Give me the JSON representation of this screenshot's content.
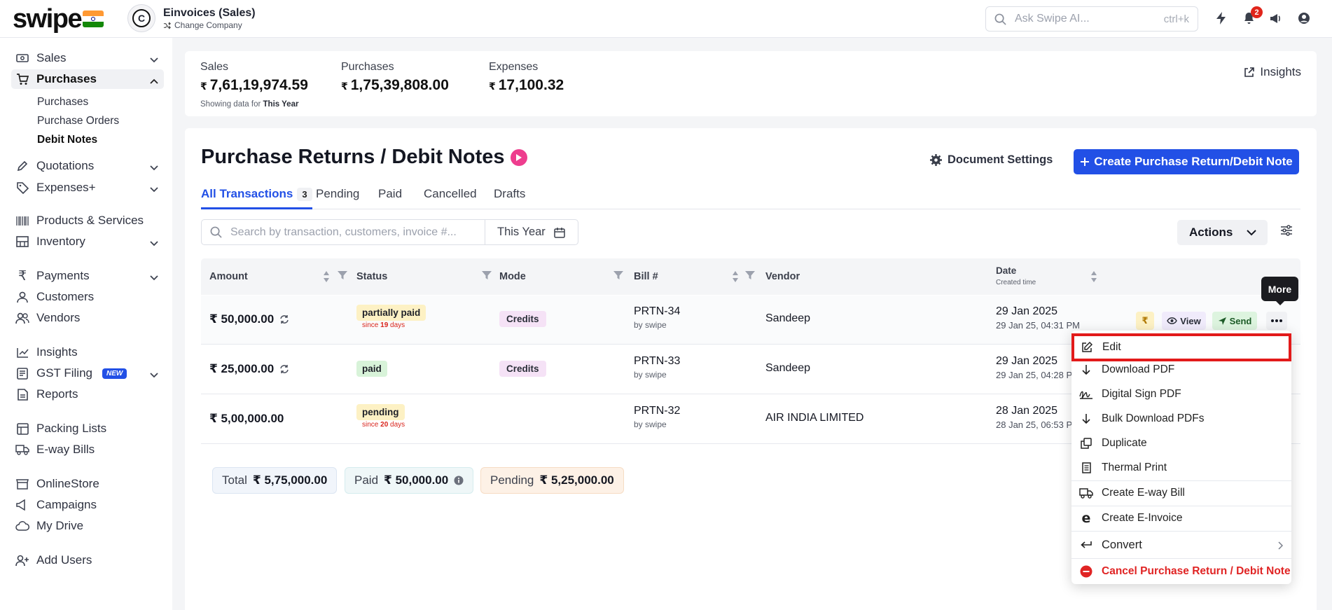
{
  "app": {
    "logo": "swipe"
  },
  "company": {
    "avatar_letter": "C",
    "name": "Einvoices (Sales)",
    "change_label": "Change Company"
  },
  "topbar": {
    "search_placeholder": "Ask Swipe AI...",
    "shortcut": "ctrl+k",
    "notifications_count": "2"
  },
  "sidebar": {
    "sales": "Sales",
    "purchases": "Purchases",
    "purchases_sub": [
      "Purchases",
      "Purchase Orders",
      "Debit Notes"
    ],
    "quotations": "Quotations",
    "expenses": "Expenses+",
    "products": "Products & Services",
    "inventory": "Inventory",
    "payments": "Payments",
    "customers": "Customers",
    "vendors": "Vendors",
    "insights": "Insights",
    "gst": "GST Filing",
    "new_badge": "NEW",
    "reports": "Reports",
    "packing": "Packing Lists",
    "eway": "E-way Bills",
    "onlinestore": "OnlineStore",
    "campaigns": "Campaigns",
    "drive": "My Drive",
    "add_users": "Add Users"
  },
  "summary": {
    "sales_label": "Sales",
    "sales_value": "7,61,19,974.59",
    "purchases_label": "Purchases",
    "purchases_value": "1,75,39,808.00",
    "expenses_label": "Expenses",
    "expenses_value": "17,100.32",
    "showing_prefix": "Showing data for",
    "showing_period": "This Year",
    "insights_label": "Insights",
    "currency": "₹"
  },
  "page": {
    "title": "Purchase Returns / Debit Notes",
    "doc_settings": "Document Settings",
    "create_button": "Create Purchase Return/Debit Note",
    "tabs": [
      {
        "label": "All Transactions",
        "count": "3"
      },
      {
        "label": "Pending"
      },
      {
        "label": "Paid"
      },
      {
        "label": "Cancelled"
      },
      {
        "label": "Drafts"
      }
    ],
    "search_placeholder": "Search by transaction, customers, invoice #...",
    "period": "This Year",
    "actions_label": "Actions"
  },
  "table": {
    "headers": {
      "amount": "Amount",
      "status": "Status",
      "mode": "Mode",
      "bill": "Bill #",
      "vendor": "Vendor",
      "date": "Date",
      "date_sub": "Created time"
    },
    "rows": [
      {
        "amount": "₹ 50,000.00",
        "status": "partially paid",
        "since_prefix": "since",
        "since_days": "19",
        "since_suffix": "days",
        "mode": "Credits",
        "bill": "PRTN-34",
        "by": "by swipe",
        "vendor": "Sandeep",
        "date": "29 Jan 2025",
        "date_sub": "29 Jan 25, 04:31 PM"
      },
      {
        "amount": "₹ 25,000.00",
        "status": "paid",
        "mode": "Credits",
        "bill": "PRTN-33",
        "by": "by swipe",
        "vendor": "Sandeep",
        "date": "29 Jan 2025",
        "date_sub": "29 Jan 25, 04:28 PM"
      },
      {
        "amount": "₹ 5,00,000.00",
        "status": "pending",
        "since_prefix": "since",
        "since_days": "20",
        "since_suffix": "days",
        "bill": "PRTN-32",
        "by": "by swipe",
        "vendor": "AIR INDIA LIMITED",
        "date": "28 Jan 2025",
        "date_sub": "28 Jan 25, 06:53 PM"
      }
    ],
    "row_actions": {
      "rupee": "₹",
      "view": "View",
      "send": "Send"
    }
  },
  "totals": {
    "total_label": "Total",
    "total_value": "₹ 5,75,000.00",
    "paid_label": "Paid",
    "paid_value": "₹ 50,000.00",
    "pending_label": "Pending",
    "pending_value": "₹ 5,25,000.00"
  },
  "tooltip": "More",
  "menu": {
    "edit": "Edit",
    "download_pdf": "Download PDF",
    "digital_sign": "Digital Sign PDF",
    "bulk_download": "Bulk Download PDFs",
    "duplicate": "Duplicate",
    "thermal": "Thermal Print",
    "eway": "Create E-way Bill",
    "einvoice": "Create E-Invoice",
    "convert": "Convert",
    "cancel": "Cancel Purchase Return / Debit Note"
  },
  "colors": {
    "accent": "#2250e6",
    "danger": "#e02424",
    "partially_paid_bg": "#fdf1c4",
    "paid_bg": "#d8f3d9",
    "pending_bg": "#fdf1c4",
    "credits_bg": "#f5e2f6"
  }
}
